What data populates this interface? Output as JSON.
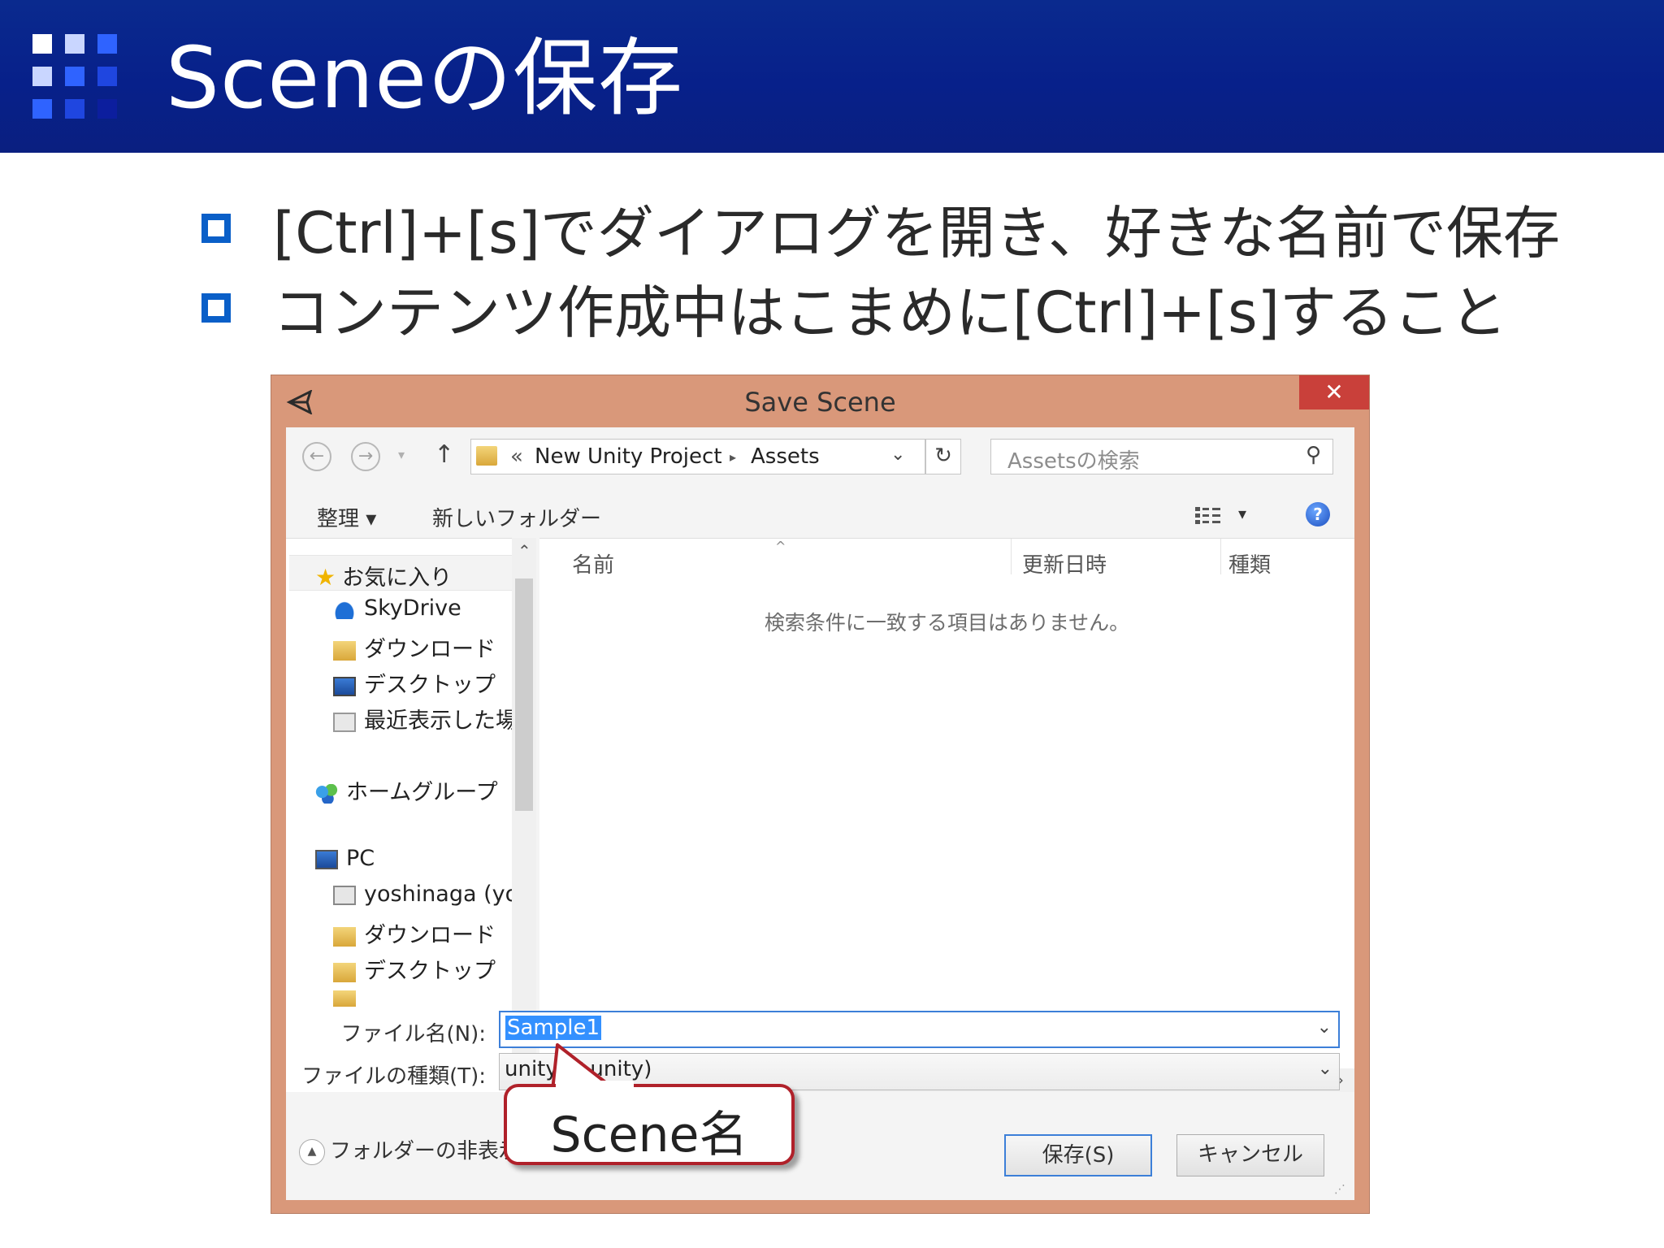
{
  "slide": {
    "title": "Sceneの保存",
    "bullets": [
      "[Ctrl]+[s]でダイアログを開き、好きな名前で保存",
      "コンテンツ作成中はこまめに[Ctrl]+[s]すること"
    ]
  },
  "dialog": {
    "title": "Save Scene",
    "close_label": "✕",
    "address": {
      "prefix": "«",
      "path": [
        "New Unity Project",
        "Assets"
      ],
      "separator": "▸"
    },
    "search_placeholder": "Assetsの検索",
    "toolbar": {
      "organize": "整理 ▾",
      "new_folder": "新しいフォルダー",
      "help": "?"
    },
    "nav": {
      "favorites": "お気に入り",
      "favorites_items": [
        "SkyDrive",
        "ダウンロード",
        "デスクトップ",
        "最近表示した場所"
      ],
      "homegroup": "ホームグループ",
      "pc": "PC",
      "pc_items": [
        "yoshinaga (yo",
        "ダウンロード",
        "デスクトップ"
      ]
    },
    "columns": [
      "名前",
      "更新日時",
      "種類"
    ],
    "empty_message": "検索条件に一致する項目はありません。",
    "filename_label": "ファイル名(N):",
    "filename_value": "Sample1",
    "filetype_label": "ファイルの種類(T):",
    "filetype_value": "unity (*.unity)",
    "hide_folders": "フォルダーの非表示",
    "save_button": "保存(S)",
    "cancel_button": "キャンセル"
  },
  "callout": {
    "text": "Scene名"
  },
  "colors": {
    "header_bg": "#07208a",
    "bullet_square": "#0a5fc8",
    "dialog_frame": "#d9987a",
    "close_button": "#c9403a",
    "callout_border": "#b0212a",
    "selection": "#3390ff"
  }
}
